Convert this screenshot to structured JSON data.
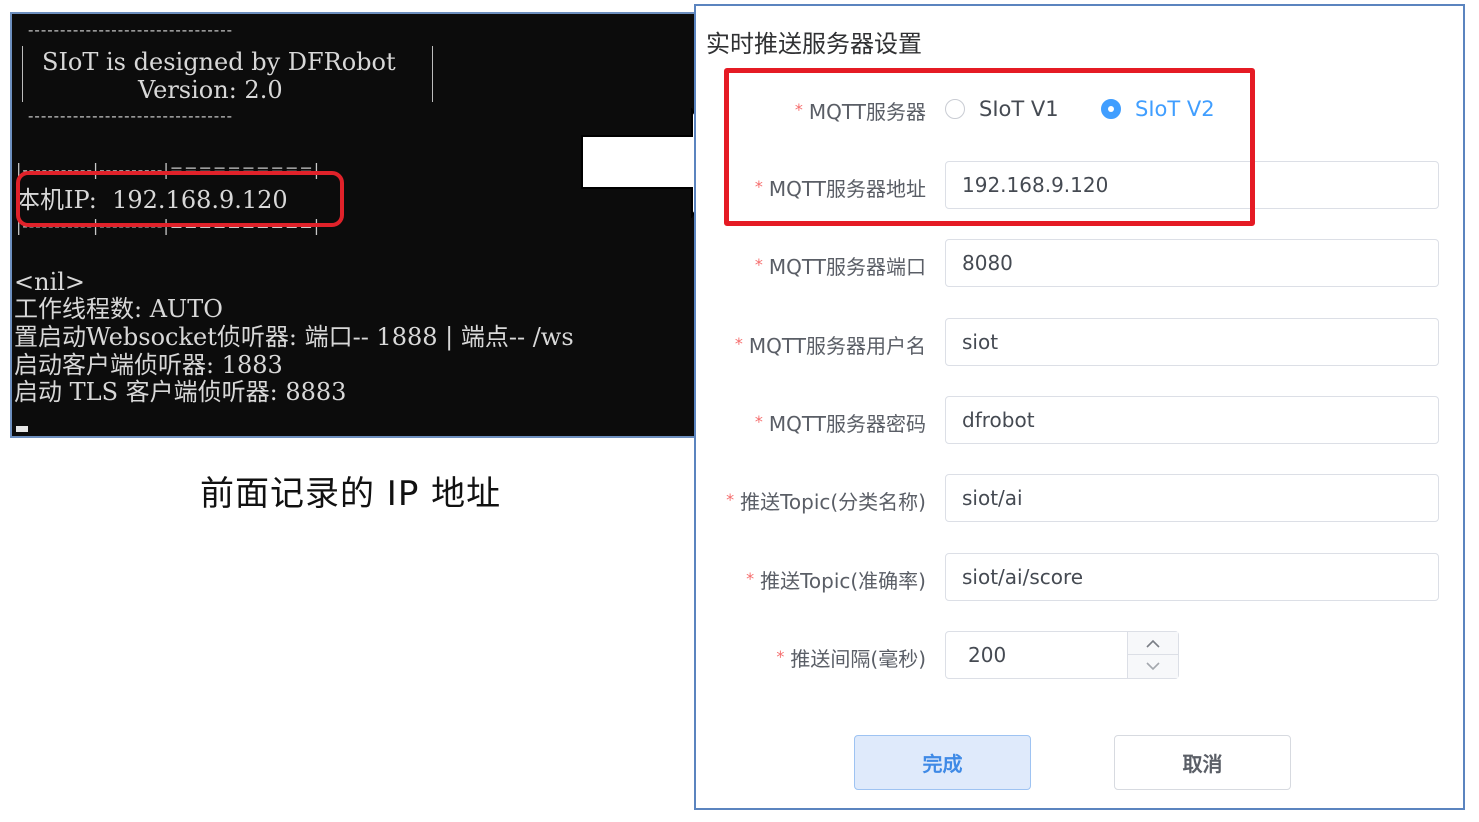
{
  "terminal": {
    "banner_line1": "SIoT is designed by DFRobot",
    "banner_line2": "Version: 2.0",
    "dash_line": "--------------------------------",
    "table_top": "|-----------|----------|==========|",
    "table_bottom": "|-----------|----------|==========|",
    "ip_line": "本机IP:  192.168.9.120",
    "nil_line": "<nil>",
    "thread_line": "工作线程数: AUTO",
    "websocket_line": "置启动Websocket侦听器: 端口-- 1888 | 端点-- /ws",
    "client_line": "启动客户端侦听器: 1883",
    "tls_line": "启动 TLS 客户端侦听器: 8883"
  },
  "caption": "前面记录的 IP 地址",
  "panel": {
    "title": "实时推送服务器设置",
    "required_mark": "*",
    "fields": {
      "server_type": {
        "label": "MQTT服务器",
        "options": [
          "SIoT V1",
          "SIoT V2"
        ],
        "selected": "SIoT V2"
      },
      "address": {
        "label": "MQTT服务器地址",
        "value": "192.168.9.120"
      },
      "port": {
        "label": "MQTT服务器端口",
        "value": "8080"
      },
      "username": {
        "label": "MQTT服务器用户名",
        "value": "siot"
      },
      "password": {
        "label": "MQTT服务器密码",
        "value": "dfrobot"
      },
      "topic_class": {
        "label": "推送Topic(分类名称)",
        "value": "siot/ai"
      },
      "topic_score": {
        "label": "推送Topic(准确率)",
        "value": "siot/ai/score"
      },
      "interval": {
        "label": "推送间隔(毫秒)",
        "value": "200"
      }
    },
    "buttons": {
      "ok": "完成",
      "cancel": "取消"
    }
  },
  "icons": {
    "stepper_up": "chevron-up-icon",
    "stepper_down": "chevron-down-icon",
    "arrow": "right-arrow-icon"
  },
  "colors": {
    "highlight_red": "#e51b24",
    "accent_blue": "#409eff",
    "terminal_bg": "#0c0c0c"
  }
}
